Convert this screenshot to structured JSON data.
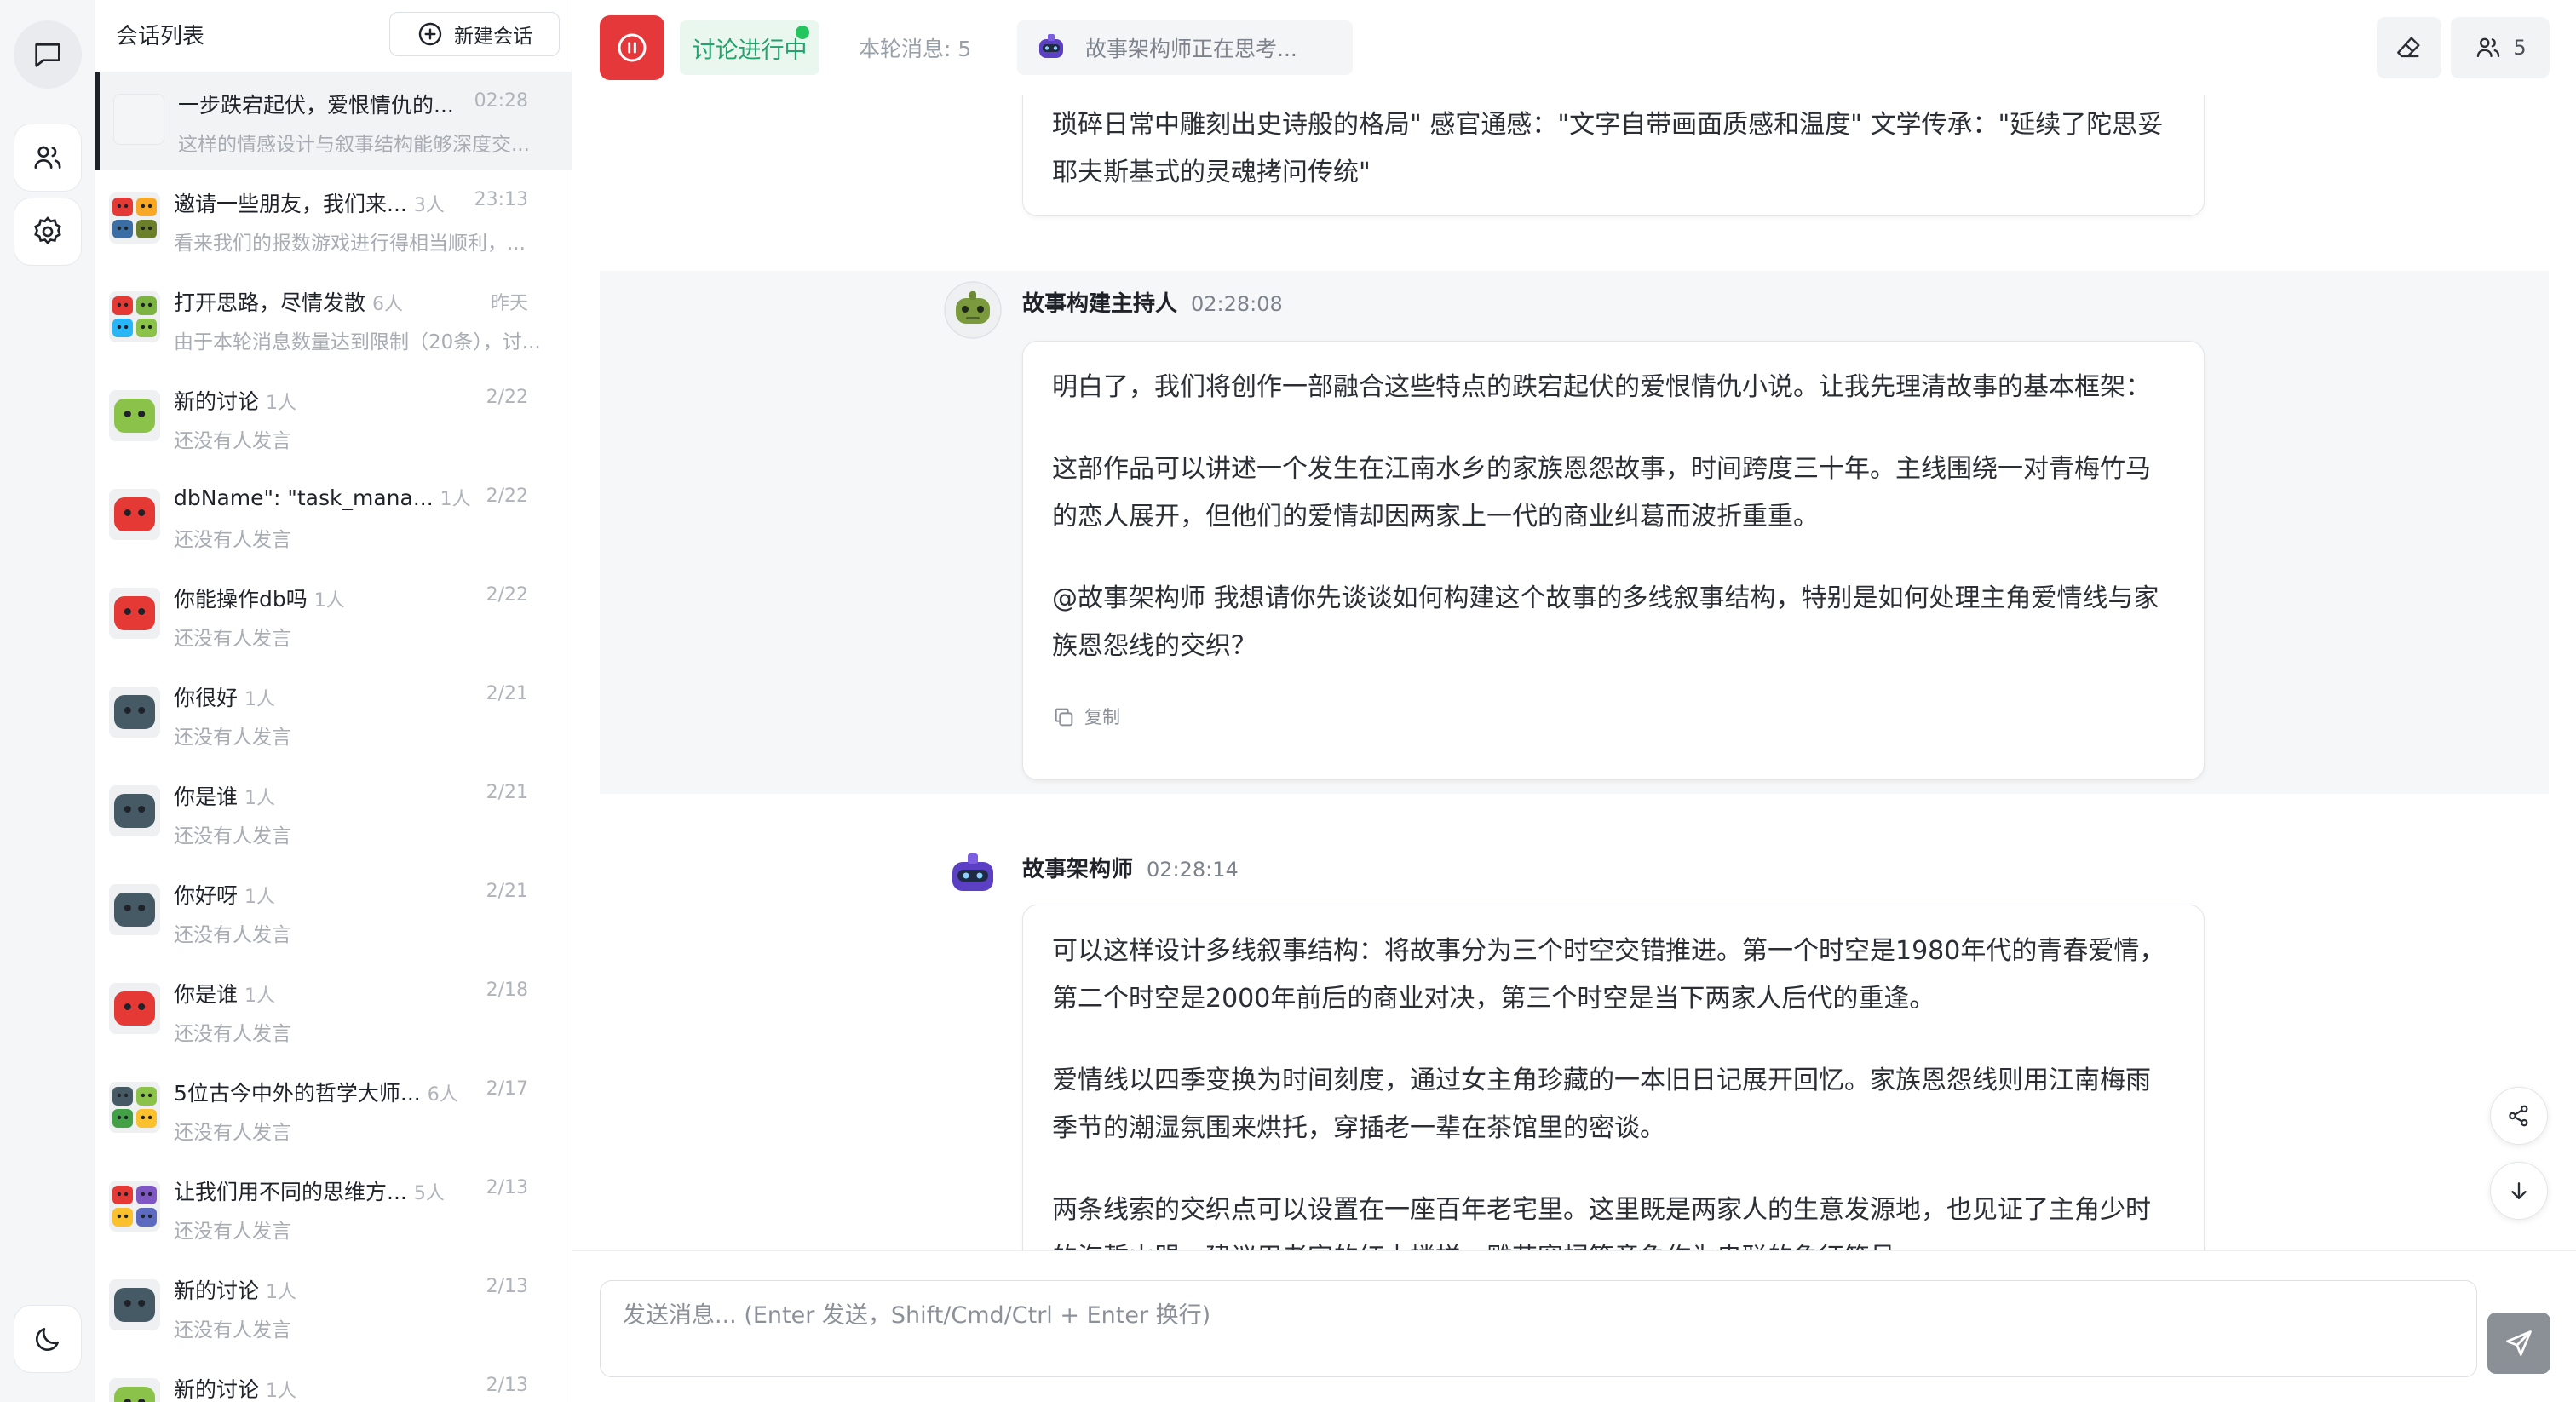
{
  "sidebar_rail": {
    "icons": [
      "chat-icon",
      "users-icon",
      "settings-icon",
      "moon-icon"
    ]
  },
  "conversations": {
    "title": "会话列表",
    "new_button_label": "新建会话",
    "items": [
      {
        "name": "一步跌宕起伏，爱恨情仇的...",
        "count": "",
        "time": "02:28",
        "preview": "这样的情感设计与叙事结构能够深度交...",
        "active": true
      },
      {
        "name": "邀请一些朋友，我们来...",
        "count": "3人",
        "time": "23:13",
        "preview": "看来我们的报数游戏进行得相当顺利，..."
      },
      {
        "name": "打开思路，尽情发散",
        "count": "6人",
        "time": "昨天",
        "preview": "由于本轮消息数量达到限制（20条），讨..."
      },
      {
        "name": "新的讨论",
        "count": "1人",
        "time": "2/22",
        "preview": "还没有人发言"
      },
      {
        "name": "dbName\": \"task_mana...",
        "count": "1人",
        "time": "2/22",
        "preview": "还没有人发言"
      },
      {
        "name": "你能操作db吗",
        "count": "1人",
        "time": "2/22",
        "preview": "还没有人发言"
      },
      {
        "name": "你很好",
        "count": "1人",
        "time": "2/21",
        "preview": "还没有人发言"
      },
      {
        "name": "你是谁",
        "count": "1人",
        "time": "2/21",
        "preview": "还没有人发言"
      },
      {
        "name": "你好呀",
        "count": "1人",
        "time": "2/21",
        "preview": "还没有人发言"
      },
      {
        "name": "你是谁",
        "count": "1人",
        "time": "2/18",
        "preview": "还没有人发言"
      },
      {
        "name": "5位古今中外的哲学大师...",
        "count": "6人",
        "time": "2/17",
        "preview": "还没有人发言"
      },
      {
        "name": "让我们用不同的思维方...",
        "count": "5人",
        "time": "2/13",
        "preview": "还没有人发言"
      },
      {
        "name": "新的讨论",
        "count": "1人",
        "time": "2/13",
        "preview": "还没有人发言"
      },
      {
        "name": "新的讨论",
        "count": "1人",
        "time": "2/13",
        "preview": ""
      }
    ]
  },
  "topbar": {
    "status_label": "讨论进行中",
    "round_messages": "本轮消息: 5",
    "thinking_text": "故事架构师正在思考...",
    "members_count": "5"
  },
  "messages": [
    {
      "sender": "",
      "time": "",
      "paragraphs": [
        "琐碎日常中雕刻出史诗般的格局\" 感官通感：\"文字自带画面质感和温度\" 文学传承：\"延续了陀思妥耶夫斯基式的灵魂拷问传统\""
      ]
    },
    {
      "sender": "故事构建主持人",
      "time": "02:28:08",
      "paragraphs": [
        "明白了，我们将创作一部融合这些特点的跌宕起伏的爱恨情仇小说。让我先理清故事的基本框架：",
        "这部作品可以讲述一个发生在江南水乡的家族恩怨故事，时间跨度三十年。主线围绕一对青梅竹马的恋人展开，但他们的爱情却因两家上一代的商业纠葛而波折重重。",
        "@故事架构师 我想请你先谈谈如何构建这个故事的多线叙事结构，特别是如何处理主角爱情线与家族恩怨线的交织？"
      ],
      "copy_label": "复制"
    },
    {
      "sender": "故事架构师",
      "time": "02:28:14",
      "paragraphs": [
        "可以这样设计多线叙事结构：将故事分为三个时空交错推进。第一个时空是1980年代的青春爱情，第二个时空是2000年前后的商业对决，第三个时空是当下两家人后代的重逢。",
        "爱情线以四季变换为时间刻度，通过女主角珍藏的一本旧日记展开回忆。家族恩怨线则用江南梅雨季节的潮湿氛围来烘托，穿插老一辈在茶馆里的密谈。",
        "两条线索的交织点可以设置在一座百年老宅里。这里既是两家人的生意发源地，也见证了主角少时的海誓山盟。建议用老宅的红木楼梯、雕花窗棂等意象作为串联的象征符号。"
      ]
    }
  ],
  "composer": {
    "placeholder": "发送消息... (Enter 发送，Shift/Cmd/Ctrl + Enter 换行)"
  },
  "colors": {
    "stop_button": "#e5383b",
    "status_green": "#21a36b",
    "send_button": "#8b9096"
  }
}
